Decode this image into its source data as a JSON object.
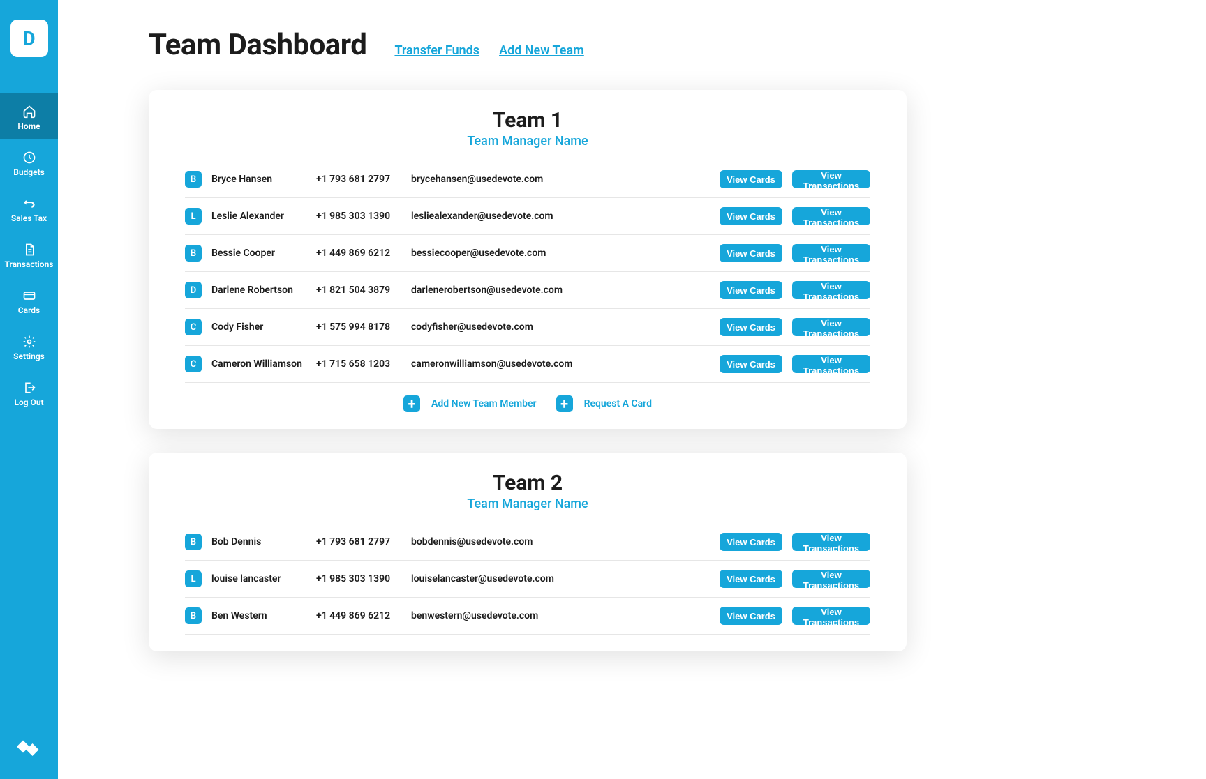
{
  "logo_letter": "D",
  "sidebar": {
    "items": [
      {
        "label": "Home",
        "icon": "home-icon",
        "active": true
      },
      {
        "label": "Budgets",
        "icon": "clock-icon",
        "active": false
      },
      {
        "label": "Sales Tax",
        "icon": "exchange-icon",
        "active": false
      },
      {
        "label": "Transactions",
        "icon": "document-icon",
        "active": false
      },
      {
        "label": "Cards",
        "icon": "card-icon",
        "active": false
      },
      {
        "label": "Settings",
        "icon": "gear-icon",
        "active": false
      },
      {
        "label": "Log Out",
        "icon": "logout-icon",
        "active": false
      }
    ]
  },
  "header": {
    "title": "Team Dashboard",
    "links": [
      {
        "label": "Transfer Funds"
      },
      {
        "label": "Add New Team"
      }
    ]
  },
  "buttons": {
    "view_cards": "View Cards",
    "view_transactions": "View Transactions"
  },
  "team_footer": {
    "add_member": "Add New Team Member",
    "request_card": "Request A Card"
  },
  "teams": [
    {
      "title": "Team 1",
      "manager": "Team Manager Name",
      "members": [
        {
          "initial": "B",
          "name": "Bryce Hansen",
          "phone": "+1 793 681 2797",
          "email": "brycehansen@usedevote.com"
        },
        {
          "initial": "L",
          "name": "Leslie Alexander",
          "phone": "+1 985 303 1390",
          "email": "lesliealexander@usedevote.com"
        },
        {
          "initial": "B",
          "name": "Bessie Cooper",
          "phone": "+1 449 869 6212",
          "email": "bessiecooper@usedevote.com"
        },
        {
          "initial": "D",
          "name": "Darlene Robertson",
          "phone": "+1 821 504 3879",
          "email": "darlenerobertson@usedevote.com"
        },
        {
          "initial": "C",
          "name": "Cody Fisher",
          "phone": "+1 575 994 8178",
          "email": "codyfisher@usedevote.com"
        },
        {
          "initial": "C",
          "name": "Cameron Williamson",
          "phone": "+1 715 658 1203",
          "email": "cameronwilliamson@usedevote.com"
        }
      ]
    },
    {
      "title": "Team 2",
      "manager": "Team Manager Name",
      "members": [
        {
          "initial": "B",
          "name": "Bob Dennis",
          "phone": "+1 793 681 2797",
          "email": "bobdennis@usedevote.com"
        },
        {
          "initial": "L",
          "name": "louise lancaster",
          "phone": "+1 985 303 1390",
          "email": "louiselancaster@usedevote.com"
        },
        {
          "initial": "B",
          "name": "Ben Western",
          "phone": "+1 449 869 6212",
          "email": "benwestern@usedevote.com"
        }
      ]
    }
  ]
}
